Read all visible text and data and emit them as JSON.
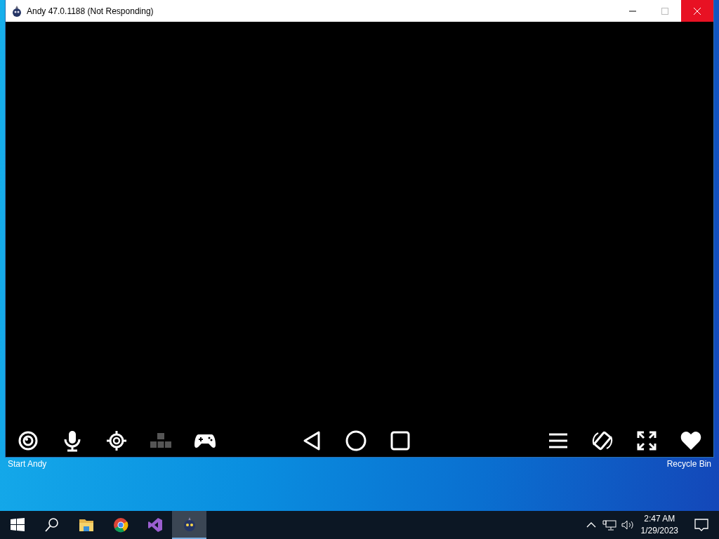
{
  "window": {
    "title": "Andy 47.0.1188 (Not Responding)",
    "close_hovered": true
  },
  "toolbar": {
    "left": [
      {
        "kind": "camera",
        "disabled": false
      },
      {
        "kind": "mic",
        "disabled": false
      },
      {
        "kind": "location",
        "disabled": false
      },
      {
        "kind": "keys",
        "disabled": true
      },
      {
        "kind": "gamepad",
        "disabled": false
      }
    ],
    "center": [
      {
        "kind": "back"
      },
      {
        "kind": "home"
      },
      {
        "kind": "recents"
      }
    ],
    "right": [
      {
        "kind": "menu"
      },
      {
        "kind": "rotate"
      },
      {
        "kind": "fullscreen"
      },
      {
        "kind": "heart"
      }
    ]
  },
  "desktop_icons": [
    {
      "label": "Start Andy"
    },
    {
      "label": "Recycle Bin"
    }
  ],
  "taskbar": {
    "items": [
      {
        "kind": "start",
        "selected": false
      },
      {
        "kind": "search",
        "selected": false
      },
      {
        "kind": "explorer",
        "selected": false
      },
      {
        "kind": "chrome",
        "selected": false
      },
      {
        "kind": "vs",
        "selected": false
      },
      {
        "kind": "andy",
        "selected": true
      }
    ],
    "time": "2:47 AM",
    "date": "1/29/2023"
  }
}
